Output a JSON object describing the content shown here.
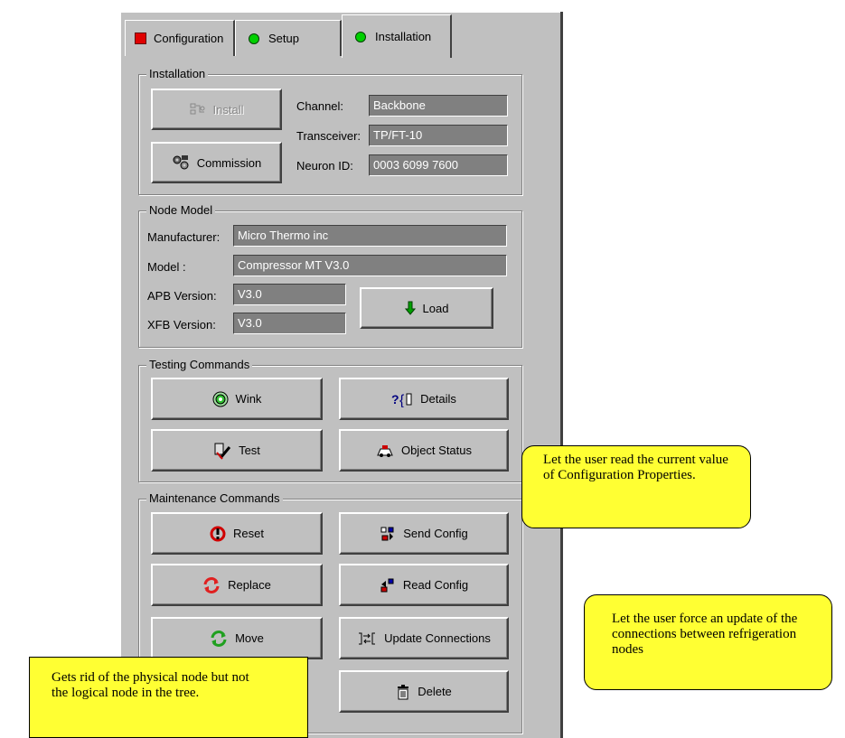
{
  "tabs": [
    {
      "label": "Configuration",
      "status_color": "#e00000",
      "status_shape": "square"
    },
    {
      "label": "Setup",
      "status_color": "#00d000",
      "status_shape": "dot"
    },
    {
      "label": "Installation",
      "status_color": "#00d000",
      "status_shape": "dot",
      "active": true
    }
  ],
  "installation": {
    "title": "Installation",
    "install_label": "Install",
    "commission_label": "Commission",
    "channel_label": "Channel:",
    "channel_value": "Backbone",
    "transceiver_label": "Transceiver:",
    "transceiver_value": "TP/FT-10",
    "neuron_label": "Neuron ID:",
    "neuron_value": "0003 6099 7600"
  },
  "node_model": {
    "title": "Node Model",
    "manufacturer_label": "Manufacturer:",
    "manufacturer_value": "Micro Thermo inc",
    "model_label": "Model :",
    "model_value": "Compressor MT V3.0",
    "apb_label": "APB Version:",
    "apb_value": "V3.0",
    "xfb_label": "XFB Version:",
    "xfb_value": "V3.0",
    "load_label": "Load"
  },
  "testing": {
    "title": "Testing Commands",
    "wink_label": "Wink",
    "details_label": "Details",
    "test_label": "Test",
    "object_status_label": "Object Status"
  },
  "maintenance": {
    "title": "Maintenance Commands",
    "reset_label": "Reset",
    "send_config_label": "Send Config",
    "replace_label": "Replace",
    "read_config_label": "Read Config",
    "move_label": "Move",
    "update_connections_label": "Update Connections",
    "delete_label": "Delete"
  },
  "callouts": {
    "read_config": "Let the user read the current value of Configuration Properties.",
    "update_connections": "Let the user force an update of the connections between refrigeration nodes",
    "delete": "Gets rid of the physical node but not the logical node in the tree."
  },
  "colors": {
    "callout_fill": "#ffff33",
    "panel": "#c0c0c0",
    "field": "#808080"
  }
}
